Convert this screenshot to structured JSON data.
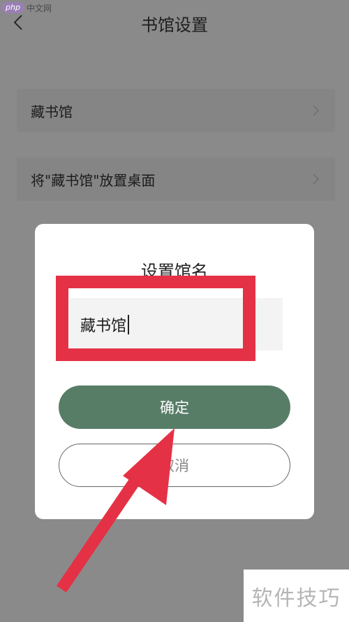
{
  "watermark_top": {
    "logo_text": "php",
    "site_name": "中文网"
  },
  "header": {
    "back_icon": "chevron-left-icon",
    "title": "书馆设置"
  },
  "list": {
    "items": [
      {
        "label": "藏书馆",
        "icon": "chevron-right-icon"
      },
      {
        "label": "将\"藏书馆\"放置桌面",
        "icon": "chevron-right-icon"
      }
    ]
  },
  "dialog": {
    "title": "设置馆名",
    "input_value": "藏书馆",
    "confirm_label": "确定",
    "cancel_label": "取消"
  },
  "colors": {
    "overlay": "#8a8a8a",
    "confirm_button": "#577d67",
    "annotation_red": "#e53145"
  },
  "watermark_bottom": {
    "text": "软件技巧"
  }
}
